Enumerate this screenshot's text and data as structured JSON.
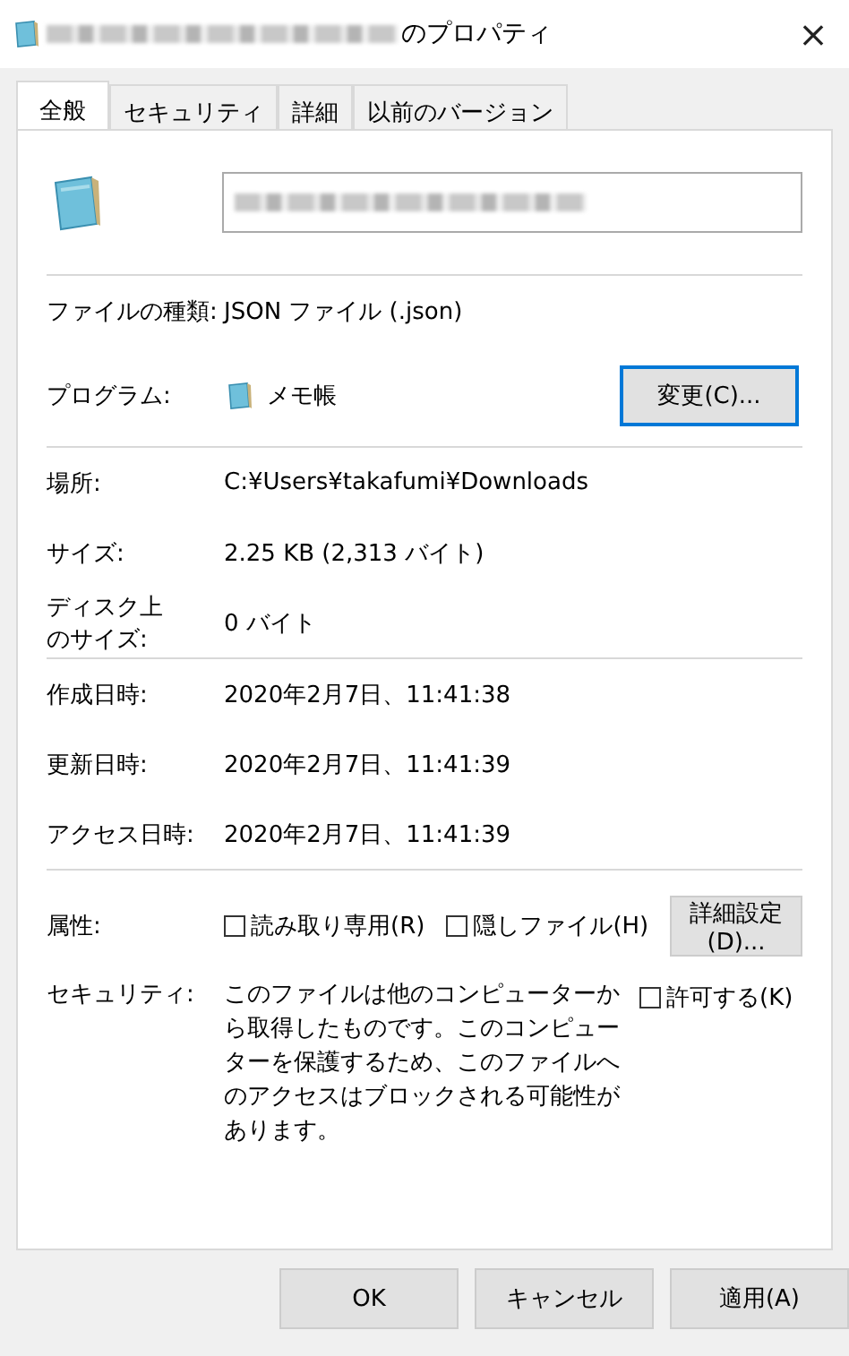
{
  "window": {
    "title": "のプロパティ",
    "close": "×"
  },
  "tabs": [
    {
      "label": "全般",
      "selected": true
    },
    {
      "label": "セキュリティ",
      "selected": false
    },
    {
      "label": "詳細",
      "selected": false
    },
    {
      "label": "以前のバージョン",
      "selected": false
    }
  ],
  "type_rows": [
    {
      "label": "ファイルの種類:",
      "value": "JSON ファイル (.json)"
    }
  ],
  "program": {
    "label": "プログラム:",
    "value": "メモ帳",
    "button": "変更(C)..."
  },
  "location_rows": [
    {
      "label": "場所:",
      "value": "C:¥Users¥takafumi¥Downloads"
    },
    {
      "label": "サイズ:",
      "value": "2.25 KB (2,313 バイト)"
    },
    {
      "label": "ディスク上のサイズ:",
      "value": "0 バイト"
    }
  ],
  "date_rows": [
    {
      "label": "作成日時:",
      "value": "2020年2月7日、11:41:38"
    },
    {
      "label": "更新日時:",
      "value": "2020年2月7日、11:41:39"
    },
    {
      "label": "アクセス日時:",
      "value": "2020年2月7日、11:41:39"
    }
  ],
  "attributes": {
    "label": "属性:",
    "options": [
      {
        "label": "読み取り専用(R)",
        "checked": false
      },
      {
        "label": "隠しファイル(H)",
        "checked": false
      }
    ],
    "button": "詳細設定(D)..."
  },
  "security": {
    "label": "セキュリティ:",
    "text": "このファイルは他のコンピューターから取得したものです。このコンピューターを保護するため、このファイルへのアクセスはブロックされる可能性があります。",
    "option": {
      "label": "許可する(K)",
      "checked": false
    }
  },
  "buttons": [
    "OK",
    "キャンセル",
    "適用(A)"
  ]
}
